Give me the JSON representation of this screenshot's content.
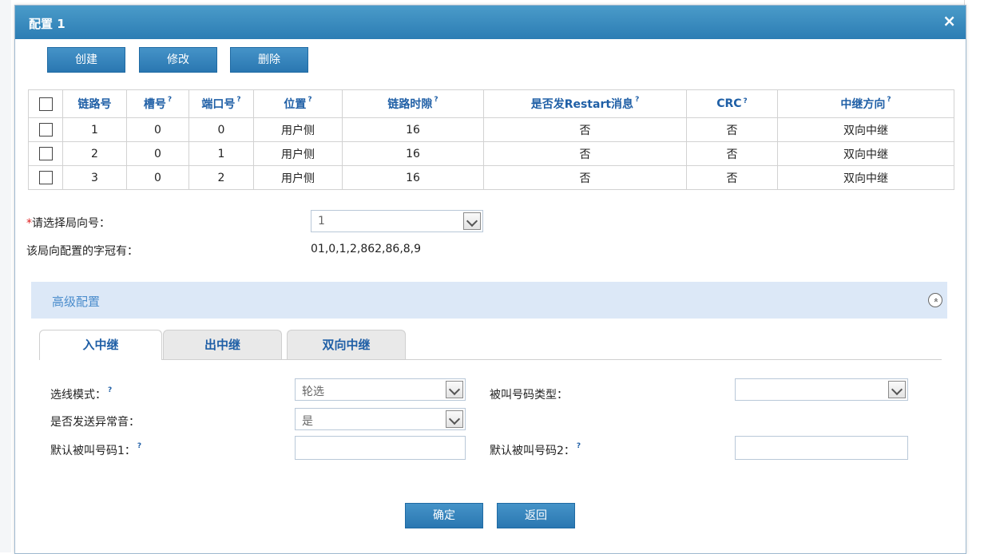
{
  "dialog": {
    "title": "配置 1",
    "close": "×"
  },
  "toolbar": {
    "create": "创建",
    "modify": "修改",
    "delete": "删除"
  },
  "table": {
    "headers": [
      "链路号",
      "槽号",
      "端口号",
      "位置",
      "链路时隙",
      "是否发Restart消息",
      "CRC",
      "中继方向"
    ],
    "help_mark": "?",
    "rows": [
      [
        "1",
        "0",
        "0",
        "用户侧",
        "16",
        "否",
        "否",
        "双向中继"
      ],
      [
        "2",
        "0",
        "1",
        "用户侧",
        "16",
        "否",
        "否",
        "双向中继"
      ],
      [
        "3",
        "0",
        "2",
        "用户侧",
        "16",
        "否",
        "否",
        "双向中继"
      ]
    ]
  },
  "form": {
    "required_mark": "*",
    "direction_label": "请选择局向号：",
    "direction_value": "1",
    "prefix_label": "该局向配置的字冠有：",
    "prefix_value": "01,0,1,2,862,86,8,9"
  },
  "advanced": {
    "title": "高级配置",
    "toggle_icon": "«"
  },
  "tabs": [
    "入中继",
    "出中继",
    "双向中继"
  ],
  "fields": {
    "select_mode_label": "选线模式：",
    "select_mode_value": "轮选",
    "called_type_label": "被叫号码类型：",
    "called_type_value": "",
    "abnormal_tone_label": "是否发送异常音：",
    "abnormal_tone_value": "是",
    "default_called1_label": "默认被叫号码1：",
    "default_called1_value": "",
    "default_called2_label": "默认被叫号码2：",
    "default_called2_value": ""
  },
  "footer": {
    "ok": "确定",
    "back": "返回"
  },
  "colors": {
    "accent": "#2c7db4",
    "header_text": "#1f5fa6",
    "advanced_bg": "#dce8f7"
  }
}
